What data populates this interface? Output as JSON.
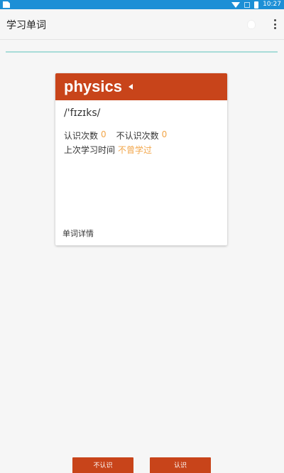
{
  "status_bar": {
    "time": "10:27"
  },
  "app_bar": {
    "title": "学习单词"
  },
  "card": {
    "word": "physics",
    "phonetic": "/'fɪzɪks/",
    "known_label": "认识次数",
    "known_count": "0",
    "unknown_label": "不认识次数",
    "unknown_count": "0",
    "last_study_label": "上次学习时间",
    "last_study_value": "不曾学过",
    "details_link": "单词详情"
  },
  "actions": {
    "unknown_label": "不认识",
    "known_label": "认识"
  },
  "colors": {
    "status_bar": "#1c8fd6",
    "accent": "#c8441a",
    "highlight": "#f2a64a",
    "progress": "#a8dcd8"
  }
}
